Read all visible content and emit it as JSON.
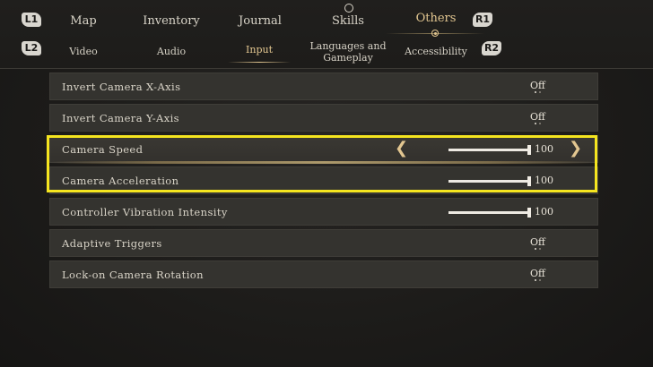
{
  "nav": {
    "tabs": [
      {
        "label": "Map"
      },
      {
        "label": "Inventory"
      },
      {
        "label": "Journal"
      },
      {
        "label": "Skills"
      },
      {
        "label": "Others"
      }
    ],
    "active_tab": "Others",
    "hints": {
      "l1": "L1",
      "r1": "R1",
      "l2": "L2",
      "r2": "R2"
    },
    "subtabs": [
      {
        "label": "Video"
      },
      {
        "label": "Audio"
      },
      {
        "label": "Input"
      },
      {
        "label": "Languages and Gameplay"
      },
      {
        "label": "Accessibility"
      }
    ],
    "active_subtab": "Input"
  },
  "settings": [
    {
      "label": "Invert Camera X-Axis",
      "type": "toggle",
      "value": "Off"
    },
    {
      "label": "Invert Camera Y-Axis",
      "type": "toggle",
      "value": "Off"
    },
    {
      "label": "Camera Speed",
      "type": "slider",
      "value": "100",
      "level": 1.0,
      "selected": true
    },
    {
      "label": "Camera Acceleration",
      "type": "slider",
      "value": "100",
      "level": 1.0
    },
    {
      "label": "Controller Vibration Intensity",
      "type": "slider",
      "value": "100",
      "level": 1.0
    },
    {
      "label": "Adaptive Triggers",
      "type": "toggle",
      "value": "Off"
    },
    {
      "label": "Lock-on Camera Rotation",
      "type": "toggle",
      "value": "Off"
    }
  ],
  "icons": {
    "left_arrow": "chevron-left-icon",
    "right_arrow": "chevron-right-icon",
    "skills": "skills-circle-icon"
  },
  "colors": {
    "accent": "#e2c690",
    "highlight": "#f5e51f"
  }
}
